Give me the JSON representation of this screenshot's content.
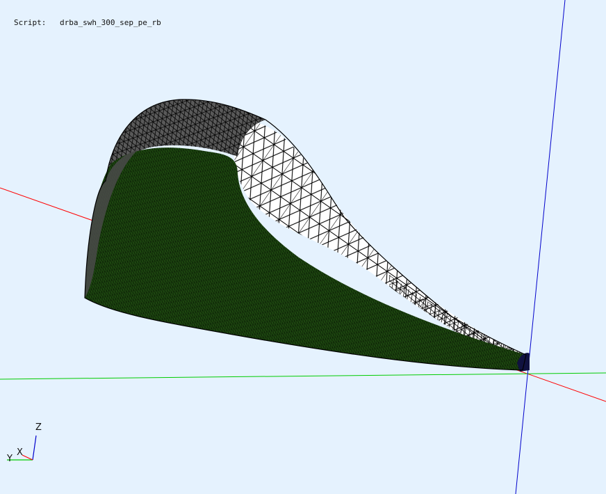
{
  "viewer": {
    "script_label": "Script:",
    "script_name": "drba_swh_300_sep_pe_rb"
  },
  "triad": {
    "z_label": "Z",
    "x_label": "X",
    "y_label": "Y"
  },
  "colors": {
    "background": "#e5f2fe",
    "x_axis": "#ff0000",
    "y_axis": "#00cc00",
    "z_axis": "#0000cc",
    "mesh_green": "#1e4a10",
    "mesh_gray": "#5a5a5a",
    "mesh_white": "#ffffff",
    "mesh_lines": "#000000",
    "tip_navy": "#101240"
  }
}
